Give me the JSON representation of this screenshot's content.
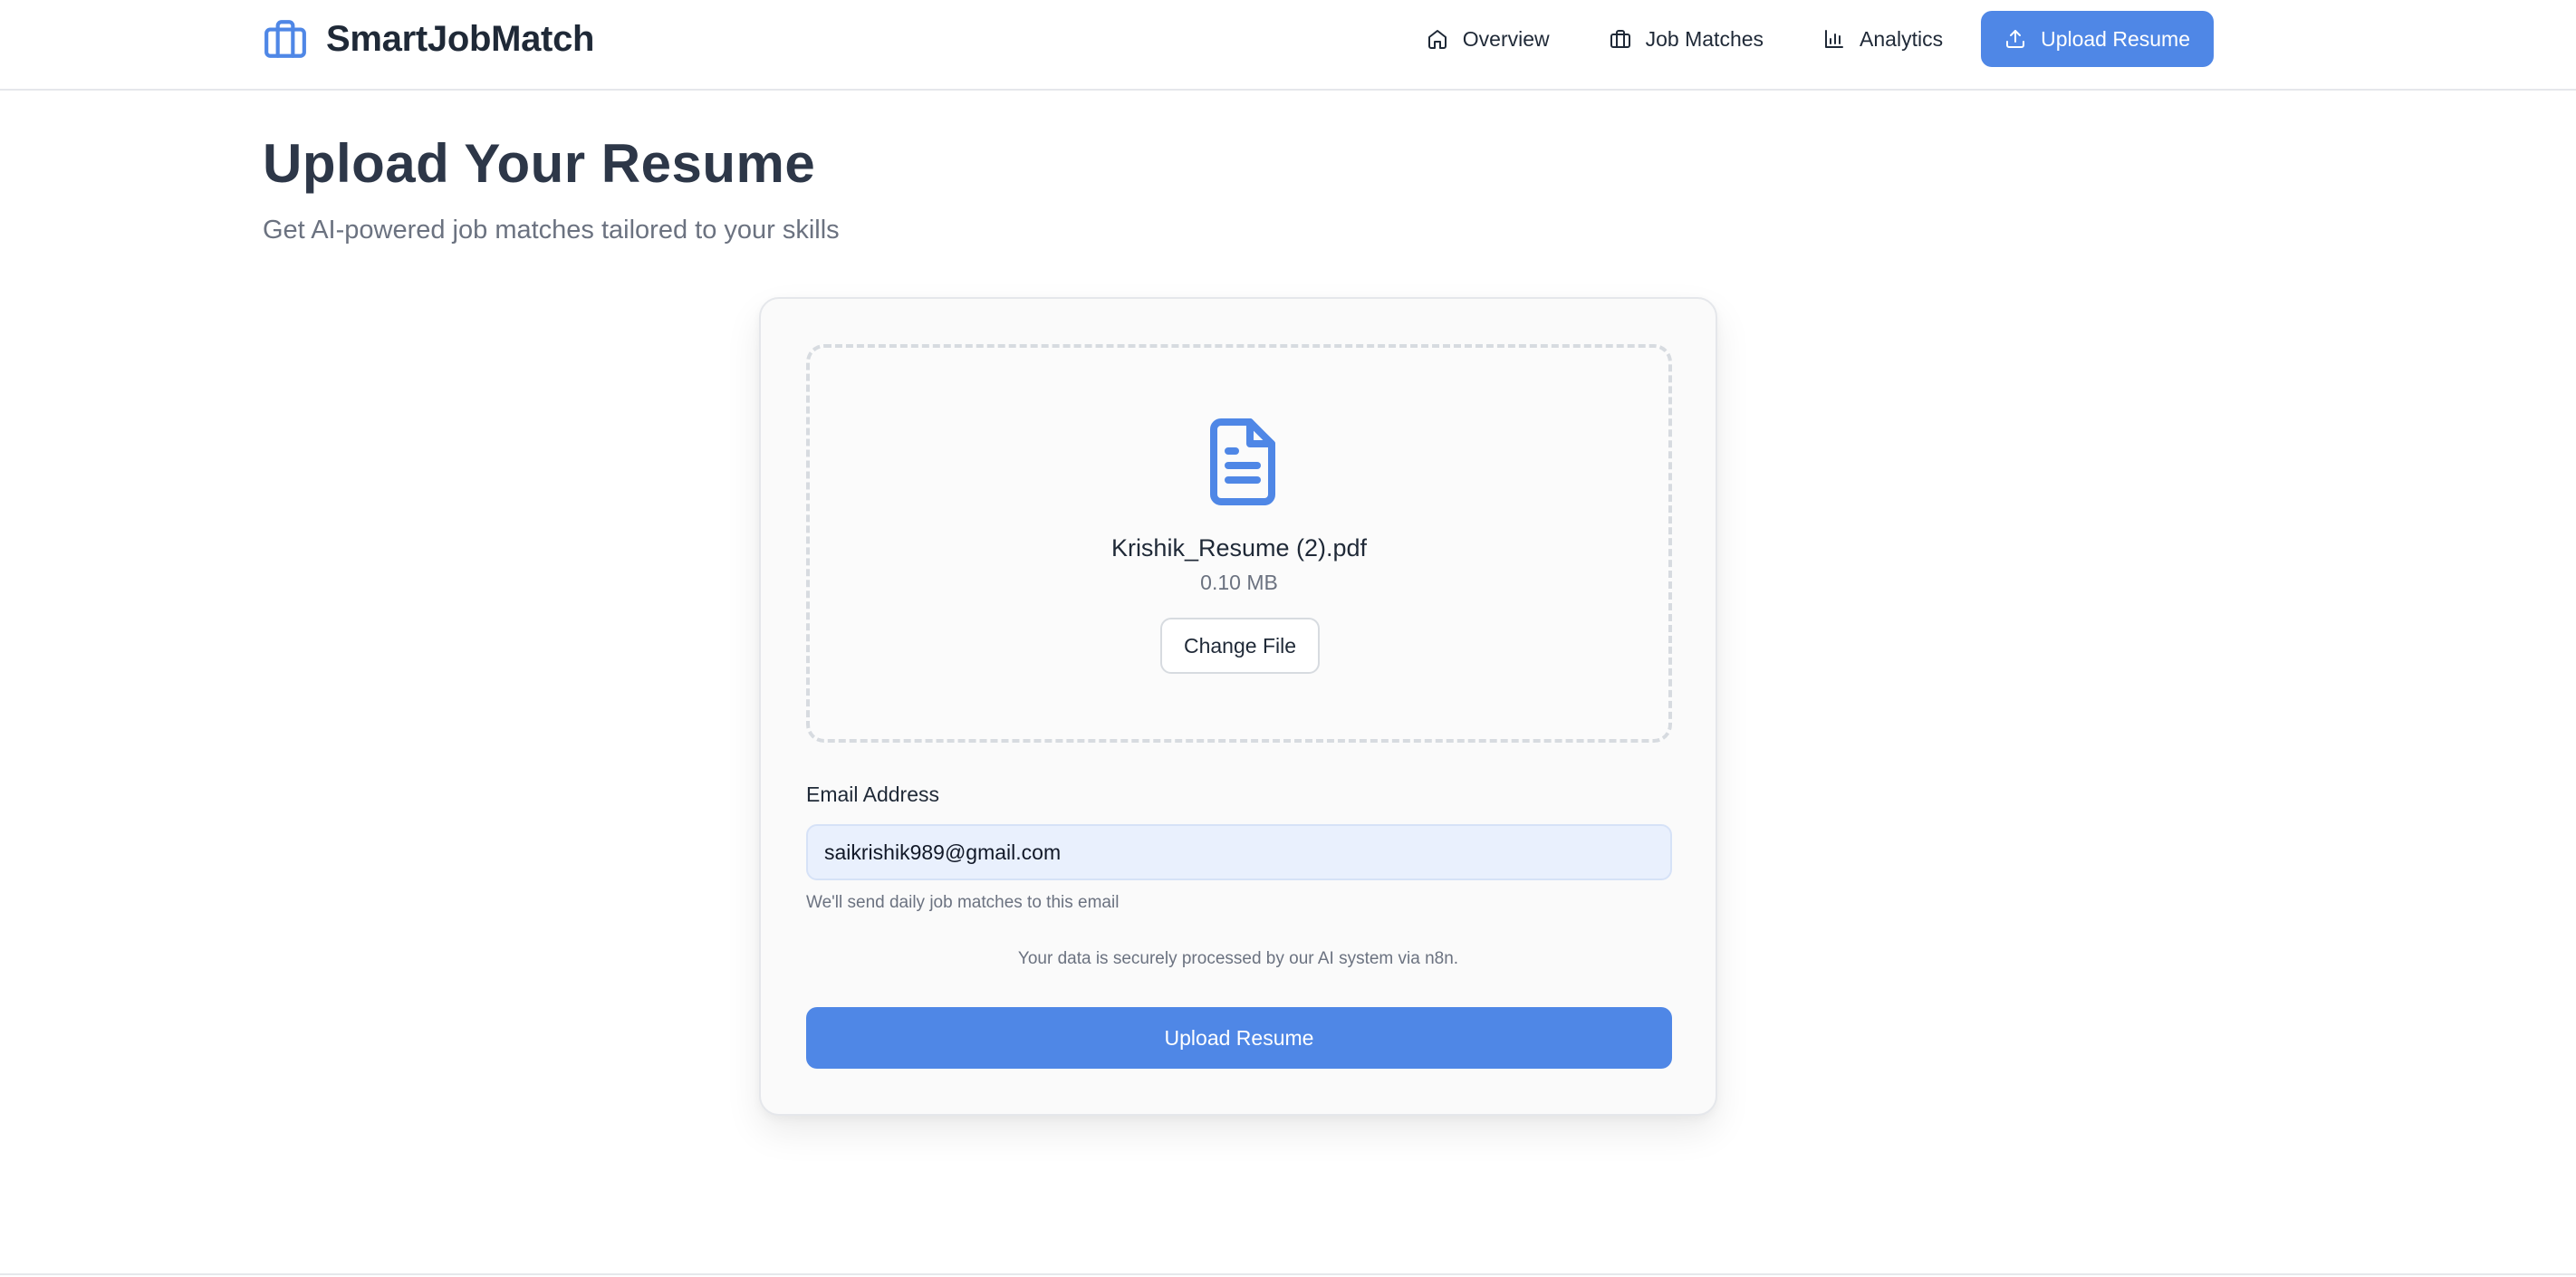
{
  "app": {
    "name": "SmartJobMatch",
    "brand_color": "#4f87e6"
  },
  "nav": {
    "items": [
      {
        "label": "Overview",
        "icon": "home-icon",
        "active": false
      },
      {
        "label": "Job Matches",
        "icon": "briefcase-icon",
        "active": false
      },
      {
        "label": "Analytics",
        "icon": "bar-chart-icon",
        "active": false
      },
      {
        "label": "Upload Resume",
        "icon": "upload-icon",
        "active": true
      }
    ]
  },
  "page": {
    "title": "Upload Your Resume",
    "subtitle": "Get AI-powered job matches tailored to your skills"
  },
  "upload": {
    "file_icon": "file-text-icon",
    "file_name": "Krishik_Resume (2).pdf",
    "file_size": "0.10 MB",
    "change_label": "Change File"
  },
  "form": {
    "email_label": "Email Address",
    "email_value": "saikrishik989@gmail.com",
    "email_hint": "We'll send daily job matches to this email",
    "secure_note": "Your data is securely processed by our AI system via n8n.",
    "submit_label": "Upload Resume"
  }
}
